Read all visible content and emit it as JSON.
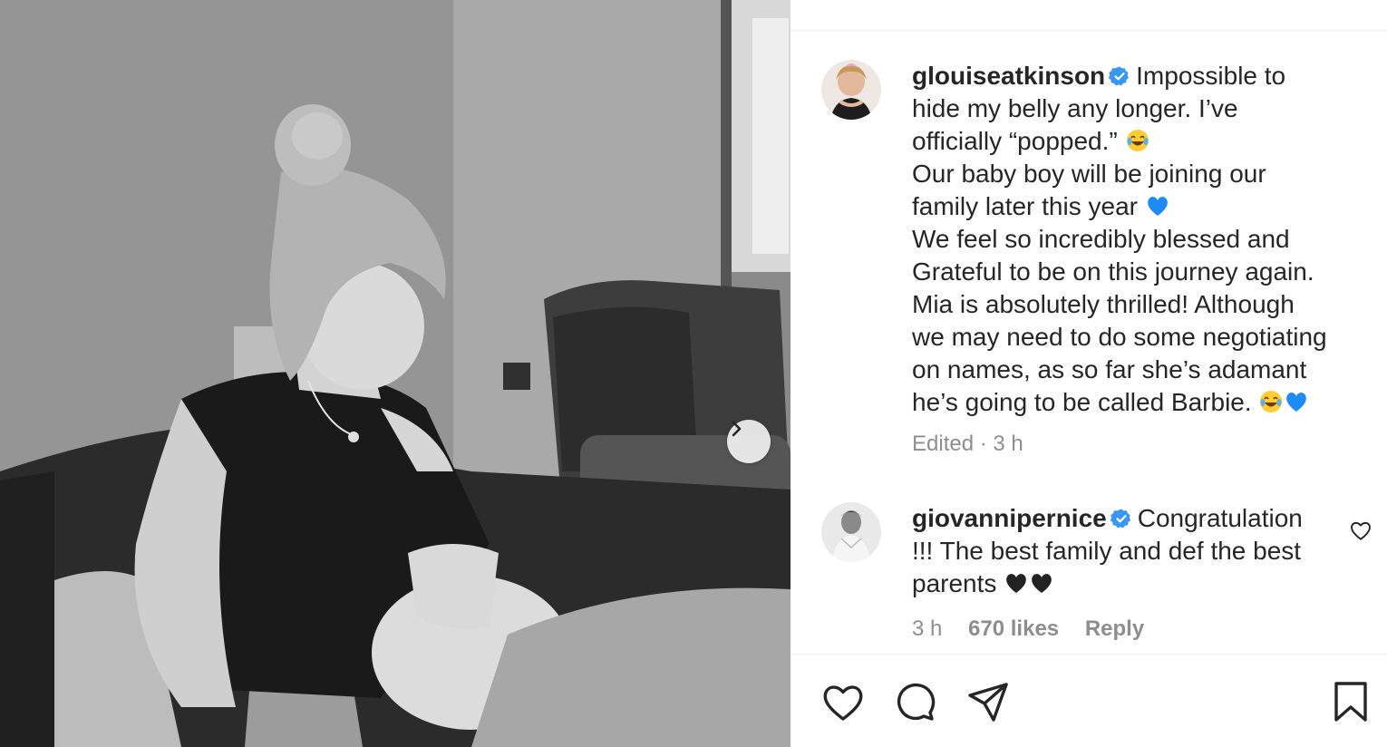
{
  "post": {
    "author": "glouiseatkinson",
    "caption_lines": [
      "Impossible to",
      "hide my belly any longer. I’ve",
      "officially “popped.”",
      "Our baby boy will be joining our",
      "family later this year",
      "We feel so incredibly blessed and",
      "Grateful to be on this journey again.",
      "Mia is absolutely thrilled! Although",
      "we may need to do some negotiating",
      "on names, as so far she’s adamant",
      "he’s going to be called Barbie."
    ],
    "edited_label": "Edited",
    "separator": "·",
    "time": "3 h"
  },
  "comment": {
    "author": "giovannipernice",
    "text_lines": [
      "Congratulation",
      "!!! The best family and def the best",
      "parents"
    ],
    "time": "3 h",
    "likes": "670 likes",
    "reply_label": "Reply"
  },
  "icons": {
    "verified": "verified-badge-icon",
    "emoji_laugh": "face-with-tears-of-joy-icon",
    "emoji_blue_heart": "blue-heart-icon",
    "emoji_black_heart": "black-heart-icon",
    "like": "heart-icon",
    "comment": "comment-bubble-icon",
    "share": "paper-plane-icon",
    "save": "bookmark-icon",
    "next": "chevron-right-icon"
  },
  "colors": {
    "verified_blue": "#3897f0",
    "text": "#262626",
    "muted": "#8e8e8e",
    "blue_heart": "#1d8cf8",
    "black_heart": "#222222"
  }
}
